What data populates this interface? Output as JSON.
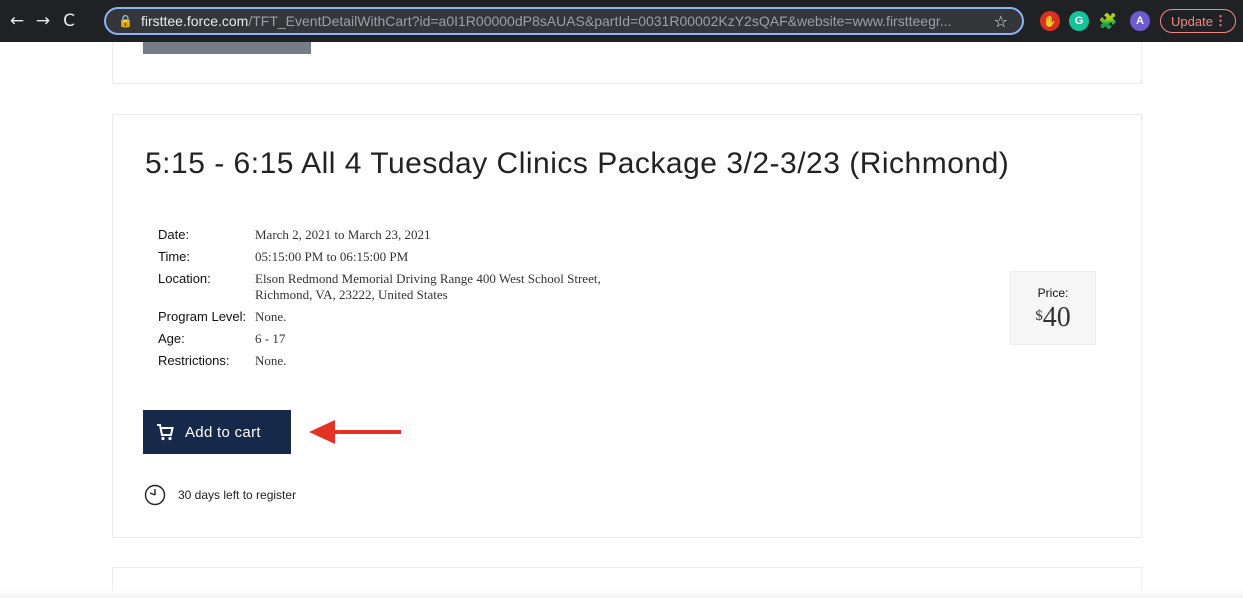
{
  "browser": {
    "nav": {
      "back": "←",
      "forward": "→",
      "reload": "C"
    },
    "url_host": "firsttee.force.com",
    "url_path": "/TFT_EventDetailWithCart?id=a0I1R00000dP8sAUAS&partId=0031R00002KzY2sQAF&website=www.firstteegr...",
    "update_label": "Update",
    "avatar_letter": "A",
    "grammarly_letter": "G"
  },
  "event": {
    "title": "5:15 - 6:15 All 4 Tuesday Clinics Package 3/2-3/23 (Richmond)",
    "details": [
      {
        "label": "Date:",
        "value": "March 2, 2021 to March 23, 2021"
      },
      {
        "label": "Time:",
        "value": "05:15:00 PM to 06:15:00 PM"
      },
      {
        "label": "Location:",
        "value": "Elson Redmond Memorial Driving Range 400 West School Street, Richmond, VA, 23222, United States"
      },
      {
        "label": "Program Level:",
        "value": "None."
      },
      {
        "label": "Age:",
        "value": "6 - 17"
      },
      {
        "label": "Restrictions:",
        "value": "None."
      }
    ],
    "price": {
      "label": "Price:",
      "currency": "$",
      "amount": "40"
    },
    "cart_button_label": "Add to cart",
    "deadline_text": "30 days left to register"
  },
  "colors": {
    "button_bg": "#17294a",
    "annotation_arrow": "#e53224"
  }
}
